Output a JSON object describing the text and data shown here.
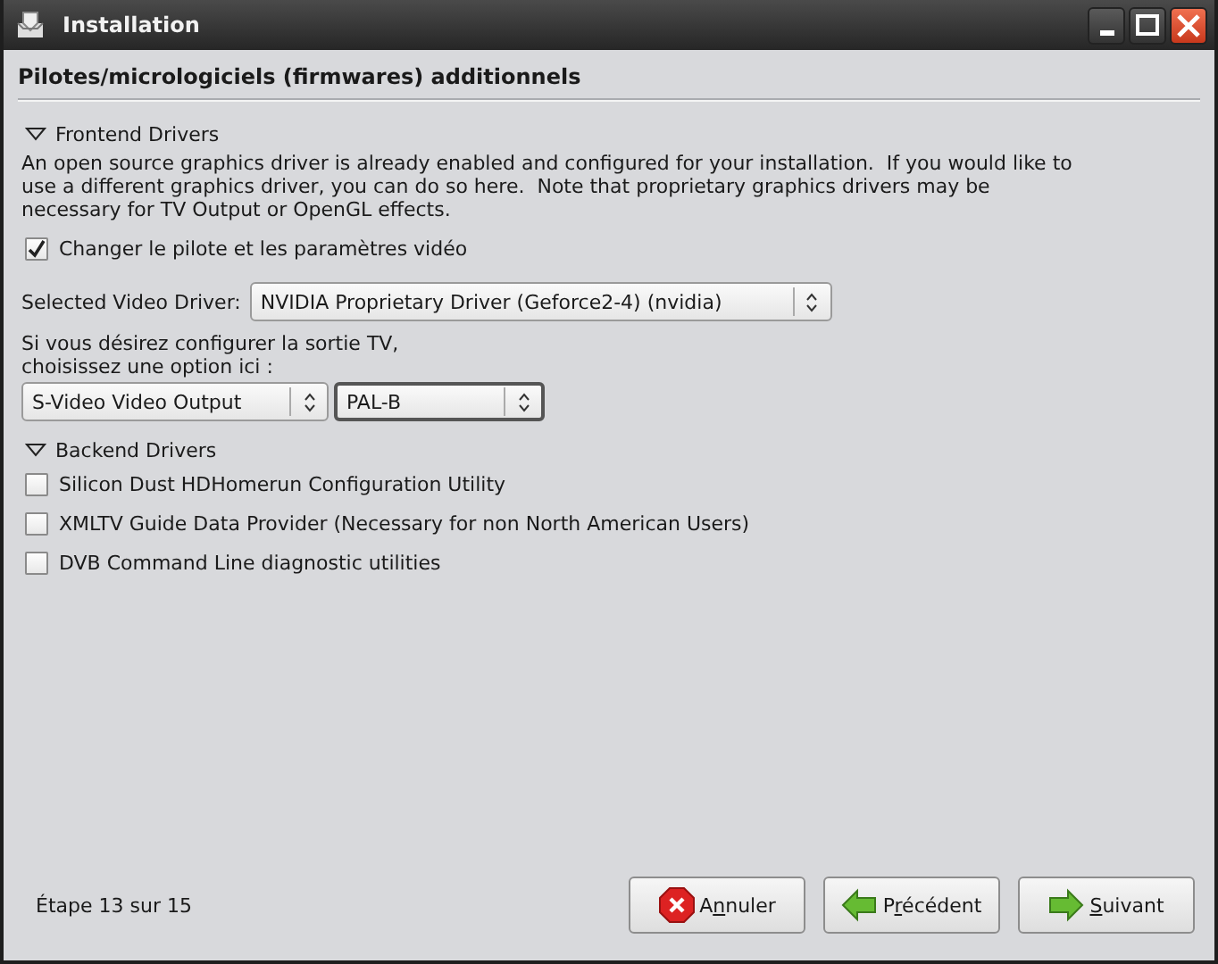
{
  "window": {
    "title": "Installation"
  },
  "page_title": "Pilotes/micrologiciels (firmwares) additionnels",
  "sections": [
    {
      "title": "Frontend Drivers",
      "expanded": true,
      "description": "An open source graphics driver is already enabled and configured for your installation.  If you would like to use a different graphics driver, you can do so here.  Note that proprietary graphics drivers may be necessary for TV Output or OpenGL effects.",
      "items": [
        {
          "kind": "checkbox",
          "label": "Changer le pilote et les paramètres vidéo",
          "checked": true
        },
        {
          "kind": "select",
          "label": "Selected Video Driver:",
          "value": "NVIDIA Proprietary Driver (Geforce2-4) (nvidia)"
        },
        {
          "kind": "select_pair",
          "label": "Si vous désirez configurer la sortie TV, choisissez une option ici :",
          "values": [
            "S-Video Video Output",
            "PAL-B"
          ]
        }
      ]
    },
    {
      "title": "Backend Drivers",
      "expanded": true,
      "items": [
        {
          "kind": "checkbox",
          "label": "Silicon Dust HDHomerun Configuration Utility",
          "checked": false
        },
        {
          "kind": "checkbox",
          "label": "XMLTV Guide Data Provider (Necessary for non North American Users)",
          "checked": false
        },
        {
          "kind": "checkbox",
          "label": "DVB Command Line diagnostic utilities",
          "checked": false
        }
      ]
    }
  ],
  "step": "Étape 13 sur 15",
  "buttons": [
    {
      "kind": "cancel",
      "label": [
        {
          "text": "A",
          "underlined": false
        },
        {
          "text": "n",
          "underlined": true
        },
        {
          "text": "nuler",
          "underlined": false
        }
      ]
    },
    {
      "kind": "back",
      "label": [
        {
          "text": "P",
          "underlined": false
        },
        {
          "text": "r",
          "underlined": true
        },
        {
          "text": "écédent",
          "underlined": false
        }
      ]
    },
    {
      "kind": "next",
      "label": [
        {
          "text": "S",
          "underlined": true
        },
        {
          "text": "uivant",
          "underlined": false
        }
      ]
    }
  ]
}
